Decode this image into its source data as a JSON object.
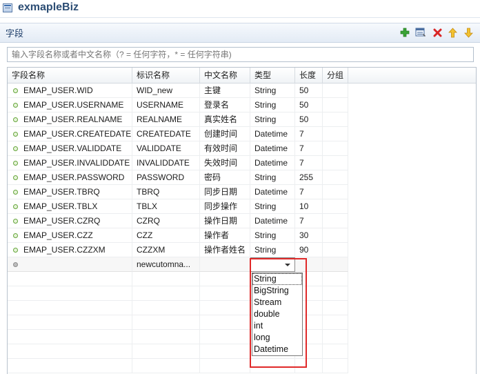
{
  "app": {
    "title": "exmapleBiz"
  },
  "section": {
    "title": "字段"
  },
  "toolbar": [
    {
      "name": "add-icon",
      "color": "#3aa335"
    },
    {
      "name": "edit-list-icon",
      "color": "#4a6ea0"
    },
    {
      "name": "delete-icon",
      "color": "#d92525"
    },
    {
      "name": "move-up-icon",
      "color": "#e7a51a"
    },
    {
      "name": "move-down-icon",
      "color": "#e7a51a"
    }
  ],
  "filter": {
    "placeholder": "输入字段名称或者中文名称（? = 任何字符，* = 任何字符串)"
  },
  "table": {
    "columns": [
      "字段名称",
      "标识名称",
      "中文名称",
      "类型",
      "长度",
      "分组"
    ],
    "rows": [
      [
        "EMAP_USER.WID",
        "WID_new",
        "主键",
        "String",
        "50",
        ""
      ],
      [
        "EMAP_USER.USERNAME",
        "USERNAME",
        "登录名",
        "String",
        "50",
        ""
      ],
      [
        "EMAP_USER.REALNAME",
        "REALNAME",
        "真实姓名",
        "String",
        "50",
        ""
      ],
      [
        "EMAP_USER.CREATEDATE",
        "CREATEDATE",
        "创建时间",
        "Datetime",
        "7",
        ""
      ],
      [
        "EMAP_USER.VALIDDATE",
        "VALIDDATE",
        "有效时间",
        "Datetime",
        "7",
        ""
      ],
      [
        "EMAP_USER.INVALIDDATE",
        "INVALIDDATE",
        "失效时间",
        "Datetime",
        "7",
        ""
      ],
      [
        "EMAP_USER.PASSWORD",
        "PASSWORD",
        "密码",
        "String",
        "255",
        ""
      ],
      [
        "EMAP_USER.TBRQ",
        "TBRQ",
        "同步日期",
        "Datetime",
        "7",
        ""
      ],
      [
        "EMAP_USER.TBLX",
        "TBLX",
        "同步操作",
        "String",
        "10",
        ""
      ],
      [
        "EMAP_USER.CZRQ",
        "CZRQ",
        "操作日期",
        "Datetime",
        "7",
        ""
      ],
      [
        "EMAP_USER.CZZ",
        "CZZ",
        "操作者",
        "String",
        "30",
        ""
      ],
      [
        "EMAP_USER.CZZXM",
        "CZZXM",
        "操作者姓名",
        "String",
        "90",
        ""
      ]
    ],
    "new_row": {
      "field": "",
      "id": "newcutomna...",
      "cn": "",
      "type": "",
      "length": "",
      "group": ""
    },
    "empty_rows": 7
  },
  "type_dropdown": {
    "options": [
      "String",
      "BigString",
      "Stream",
      "double",
      "int",
      "long",
      "Datetime"
    ],
    "selected": "String"
  }
}
